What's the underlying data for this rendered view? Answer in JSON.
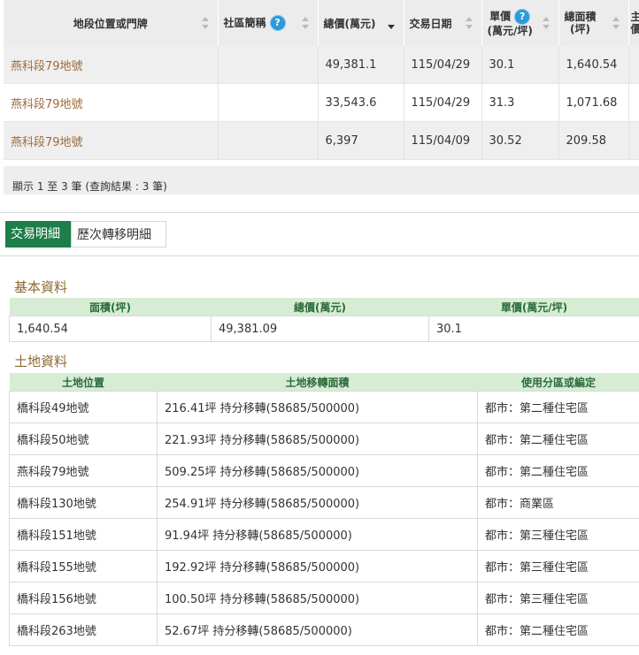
{
  "results": {
    "columns": {
      "location": "地段位置或門牌",
      "community": "社區簡稱",
      "total_price": "總價(萬元)",
      "date": "交易日期",
      "unit_price_l1": "單價",
      "unit_price_l2": "(萬元/坪)",
      "area_l1": "總面積",
      "area_l2": "(坪)",
      "extra_l1": "主",
      "extra_l2": "價"
    },
    "rows": [
      {
        "location": "燕科段79地號",
        "community": "",
        "total_price": "49,381.1",
        "date": "115/04/29",
        "unit_price": "30.1",
        "area": "1,640.54"
      },
      {
        "location": "燕科段79地號",
        "community": "",
        "total_price": "33,543.6",
        "date": "115/04/29",
        "unit_price": "31.3",
        "area": "1,071.68"
      },
      {
        "location": "燕科段79地號",
        "community": "",
        "total_price": "6,397",
        "date": "115/04/09",
        "unit_price": "30.52",
        "area": "209.58"
      }
    ],
    "summary": "顯示 1 至 3 筆 (查詢結果 : 3 筆)"
  },
  "tabs": [
    "交易明細",
    "歷次轉移明細"
  ],
  "basic": {
    "title": "基本資料",
    "headers": [
      "面積(坪)",
      "總價(萬元)",
      "單價(萬元/坪)"
    ],
    "values": [
      "1,640.54",
      "49,381.09",
      "30.1"
    ]
  },
  "land": {
    "title": "土地資料",
    "headers": [
      "土地位置",
      "土地移轉面積",
      "使用分區或編定"
    ],
    "rows": [
      [
        "橋科段49地號",
        "216.41坪 持分移轉(58685/500000)",
        "都市：第二種住宅區"
      ],
      [
        "橋科段50地號",
        "221.93坪 持分移轉(58685/500000)",
        "都市：第二種住宅區"
      ],
      [
        "燕科段79地號",
        "509.25坪 持分移轉(58685/500000)",
        "都市：第二種住宅區"
      ],
      [
        "橋科段130地號",
        "254.91坪 持分移轉(58685/500000)",
        "都市：商業區"
      ],
      [
        "橋科段151地號",
        "91.94坪 持分移轉(58685/500000)",
        "都市：第三種住宅區"
      ],
      [
        "橋科段155地號",
        "192.92坪 持分移轉(58685/500000)",
        "都市：第三種住宅區"
      ],
      [
        "橋科段156地號",
        "100.50坪 持分移轉(58685/500000)",
        "都市：第三種住宅區"
      ],
      [
        "橋科段263地號",
        "52.67坪 持分移轉(58685/500000)",
        "都市：第二種住宅區"
      ]
    ]
  },
  "icons": {
    "help": "help-icon",
    "sort": "sort-icon"
  },
  "colors": {
    "tab_active": "#1e7e4a",
    "header_green": "#d6ecd4",
    "section_title": "#8a6a33",
    "link": "#9a6b3a",
    "help": "#2c9ad8"
  }
}
